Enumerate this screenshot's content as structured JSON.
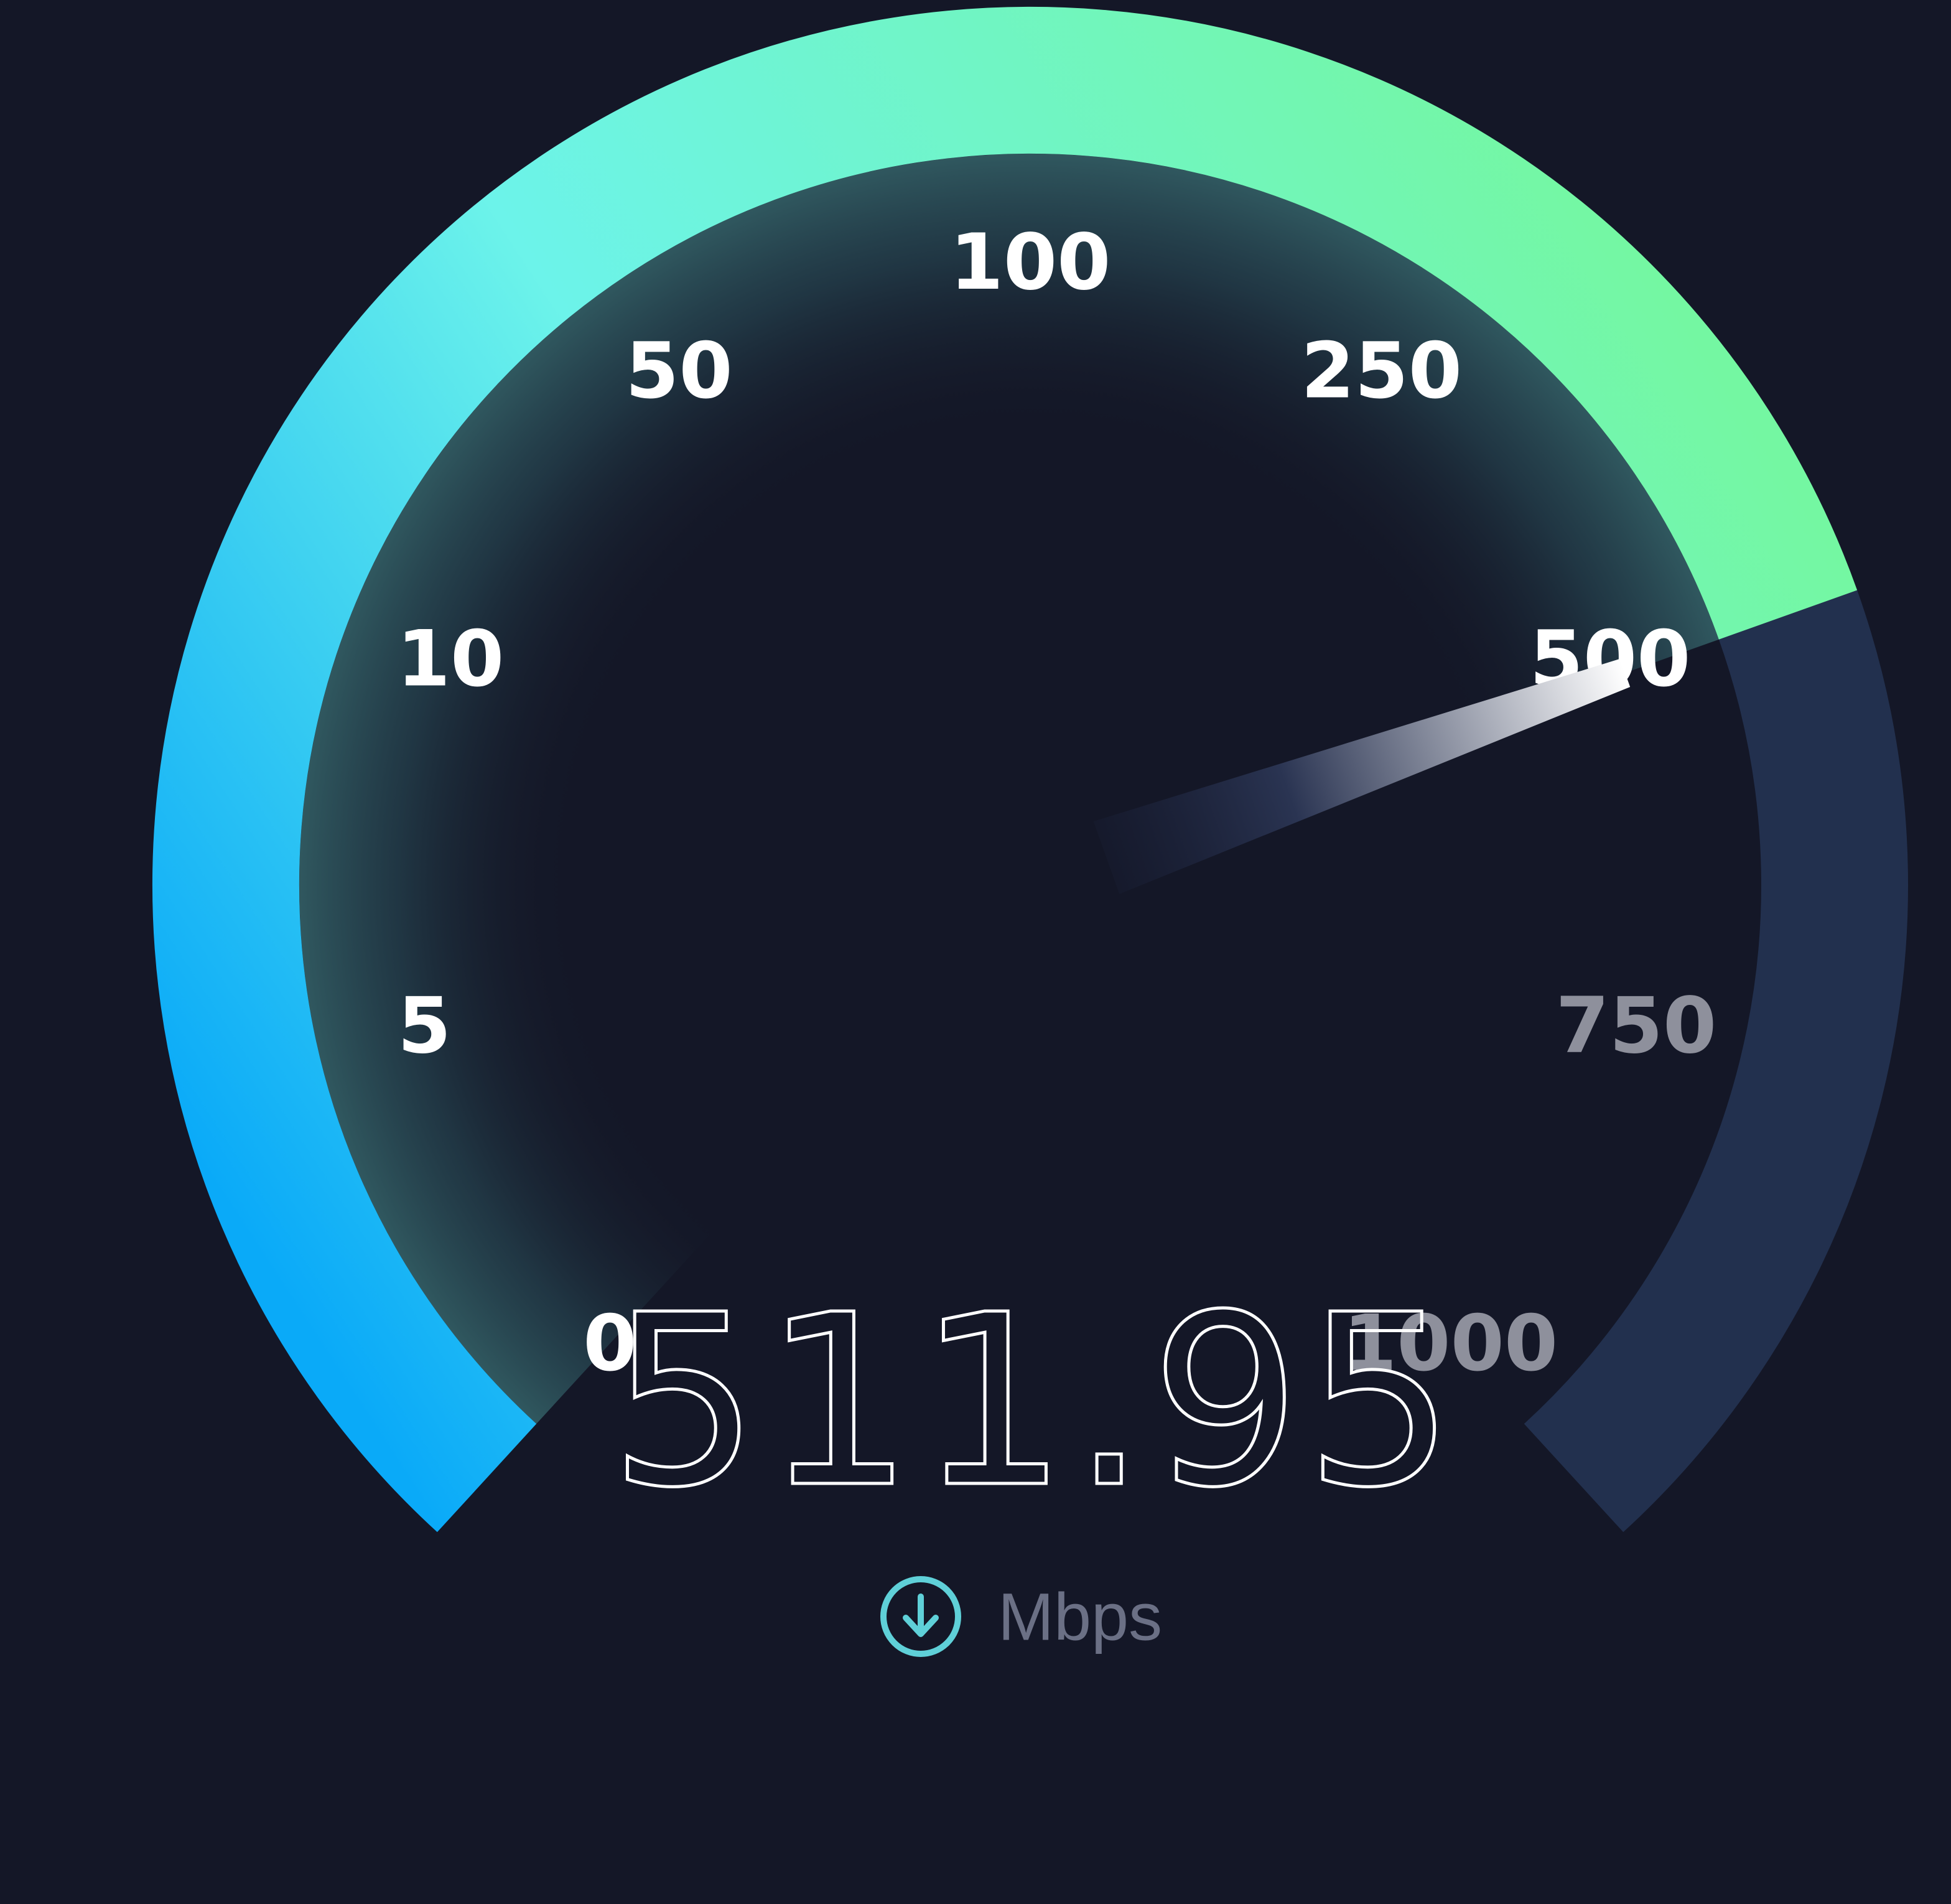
{
  "gauge": {
    "value": 511.95,
    "scale": [
      0,
      5,
      10,
      50,
      100,
      250,
      500,
      750,
      1000
    ],
    "active_label_color": "#ffffff",
    "inactive_label_color": "#8e909c"
  },
  "readout": {
    "value_text": "511.95",
    "unit": "Mbps",
    "direction_icon": "download-arrow-icon"
  },
  "colors": {
    "background": "#141727",
    "arc_start": "#0aaaf8",
    "arc_mid": "#6cf3ea",
    "arc_end": "#74f7a2",
    "arc_remaining": "#22304e",
    "icon": "#5fd0d8"
  }
}
